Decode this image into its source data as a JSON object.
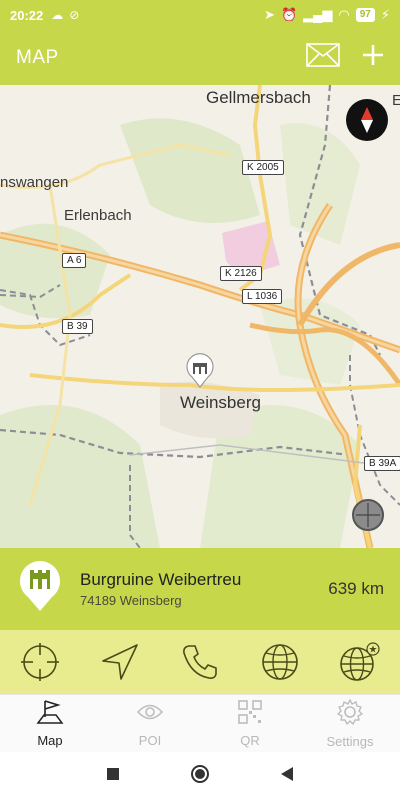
{
  "status": {
    "time": "20:22",
    "battery": "97"
  },
  "appbar": {
    "title": "MAP",
    "mail_icon": "envelope-icon",
    "add_icon": "plus-icon"
  },
  "map": {
    "places": [
      "Gellmersbach",
      "Erlenbach",
      "nswangen",
      "Weinsberg",
      "E"
    ],
    "roads": [
      "K 2005",
      "A 6",
      "K 2126",
      "L 1036",
      "B 39",
      "B 39A"
    ]
  },
  "poi": {
    "name": "Burgruine Weibertreu",
    "address": "74189 Weinsberg",
    "distance": "639 km"
  },
  "tabs": [
    {
      "label": "Map",
      "icon": "flag-icon"
    },
    {
      "label": "POI",
      "icon": "eye-icon"
    },
    {
      "label": "QR",
      "icon": "qr-code-icon"
    },
    {
      "label": "Settings",
      "icon": "gear-icon"
    }
  ],
  "colors": {
    "accent": "#c6d84a",
    "actionbar": "#e8ec8f",
    "icon_dark": "#4a4a1a"
  }
}
